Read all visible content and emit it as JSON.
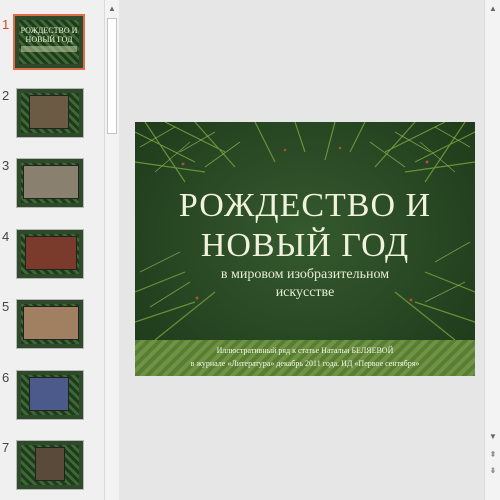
{
  "thumbnails": [
    {
      "number": "1",
      "title": "РОЖДЕСТВО И НОВЫЙ ГОД",
      "active": true,
      "photo": ""
    },
    {
      "number": "2",
      "title": "",
      "active": false,
      "photo": "#6b5a44"
    },
    {
      "number": "3",
      "title": "",
      "active": false,
      "photo": "#8a8070"
    },
    {
      "number": "4",
      "title": "",
      "active": false,
      "photo": "#7a3b2c"
    },
    {
      "number": "5",
      "title": "",
      "active": false,
      "photo": "#a08060"
    },
    {
      "number": "6",
      "title": "",
      "active": false,
      "photo": "#4b5a8a"
    },
    {
      "number": "7",
      "title": "",
      "active": false,
      "photo": "#5a4a3a"
    }
  ],
  "slide": {
    "title_line1": "РОЖДЕСТВО И",
    "title_line2": "НОВЫЙ ГОД",
    "subtitle_line1": "в мировом изобразительном",
    "subtitle_line2": "искусстве",
    "caption_line1": "Иллюстративный ряд к статье Натальи БЕЛЯЕВОЙ",
    "caption_line2": "в журнале «Литература» декабрь 2011 года. ИД «Первое сентября»"
  },
  "icons": {
    "scroll_up": "▲",
    "scroll_down": "▼",
    "prev_slide": "⇞",
    "next_slide": "⇟"
  },
  "colors": {
    "active_thumb_border": "#e06c4a",
    "slide_green": "#2a4a25"
  }
}
